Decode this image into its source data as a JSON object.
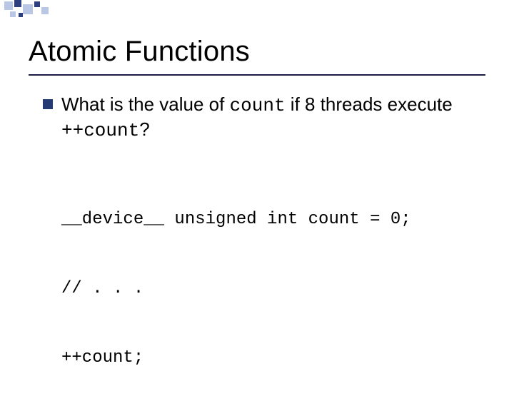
{
  "title": "Atomic Functions",
  "bullet": {
    "pre1": "What is the value of ",
    "code1": "count",
    "mid": " if 8 threads execute ",
    "code2": "++count",
    "post": "?"
  },
  "code": {
    "l1": "__device__ unsigned int count = 0;",
    "l2": "// . . .",
    "l3": "++count;"
  }
}
